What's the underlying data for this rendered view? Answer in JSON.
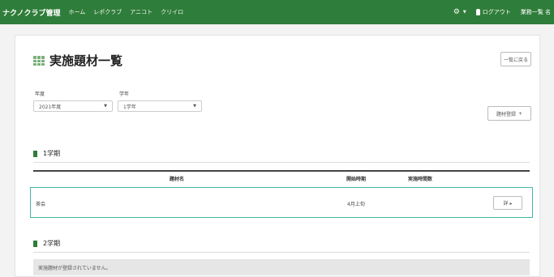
{
  "header": {
    "brand": "ナクノクラブ管理",
    "nav": [
      "ホーム",
      "レポクラブ",
      "アニコト",
      "クリイロ"
    ],
    "right_items": [
      "",
      "ログアウト",
      "業務一覧 名"
    ]
  },
  "page": {
    "title": "実施題材一覧",
    "back_button": "一覧に戻る"
  },
  "filters": {
    "year_label": "年度",
    "year_value": "2021年度",
    "grade_label": "学年",
    "grade_value": "1学年"
  },
  "register_button": "題材登録",
  "sections": {
    "term1": "1学期",
    "term2": "2学期"
  },
  "table": {
    "headers": [
      "題材名",
      "開始時期",
      "実施時間数"
    ],
    "rows": [
      {
        "name": "茶会",
        "start": "4月上旬",
        "hours": "",
        "action": "詳 ▸"
      }
    ]
  },
  "term2_notice": "実施題材が登録されていません。",
  "colors": {
    "header": "#2f7d3a",
    "accent": "#3fb7a5"
  }
}
